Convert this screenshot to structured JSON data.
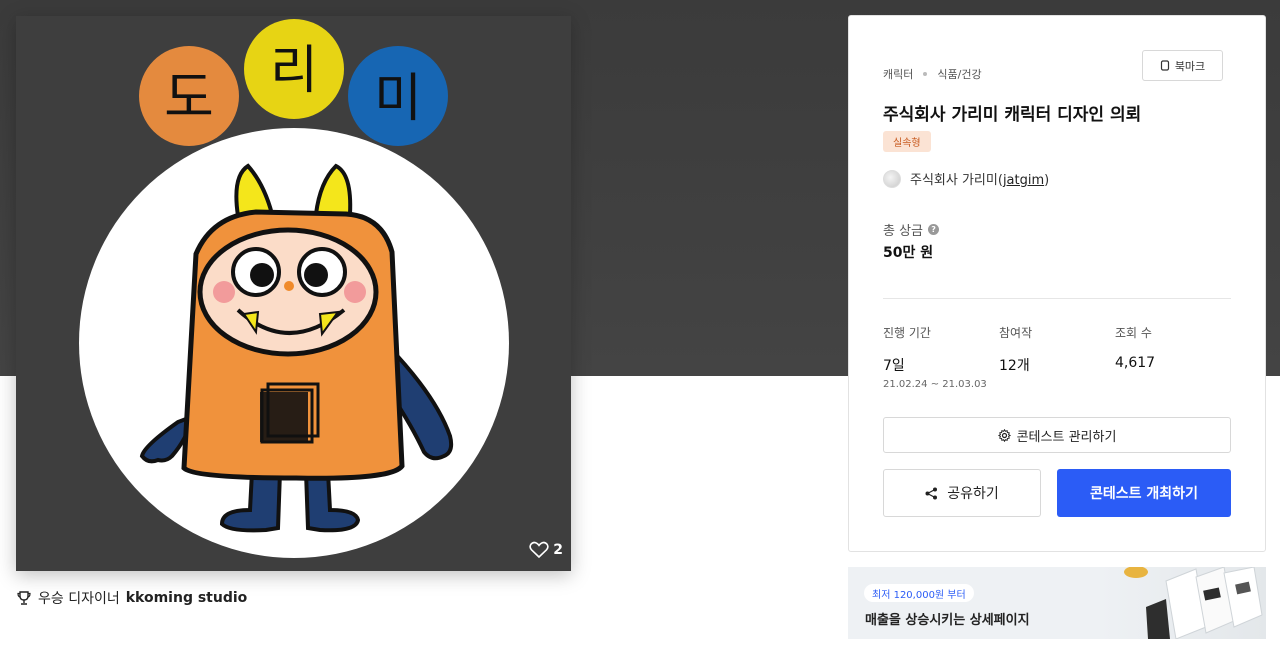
{
  "hero": {
    "character_text": [
      "도",
      "리",
      "미"
    ],
    "like_count": "2"
  },
  "winner": {
    "label": "우승 디자이너",
    "name": "kkoming studio"
  },
  "panel": {
    "breadcrumbs": [
      "캐릭터",
      "식품/건강"
    ],
    "bookmark_label": "북마크",
    "title": "주식회사 가리미 캐릭터 디자인 의뢰",
    "badge": "실속형",
    "host_name": "주식회사 가리미",
    "host_handle": "jatgim",
    "prize_label": "총 상금",
    "prize_value": "50만 원",
    "stats": {
      "duration_label": "진행 기간",
      "duration_value": "7일",
      "duration_dates": "21.02.24 ~ 21.03.03",
      "participants_label": "참여작",
      "participants_value": "12개",
      "views_label": "조회 수",
      "views_value": "4,617"
    },
    "manage_label": "콘테스트 관리하기",
    "share_label": "공유하기",
    "host_button_label": "콘테스트 개최하기"
  },
  "ad": {
    "pill": "최저 120,000원 부터",
    "headline": "매출을 상승시키는 상세페이지"
  },
  "colors": {
    "primary": "#2b5cf6",
    "badge_bg": "#fbe3d4",
    "badge_text": "#c85a1f",
    "character_orange": "#f0923c",
    "bubble_orange": "#e48a3e",
    "bubble_yellow": "#e7d414",
    "bubble_blue": "#1766b3"
  }
}
